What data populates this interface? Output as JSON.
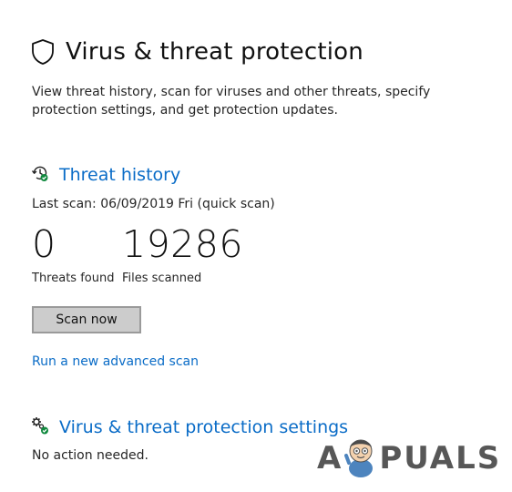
{
  "page": {
    "title": "Virus & threat protection",
    "description": "View threat history, scan for viruses and other threats, specify protection settings, and get protection updates.",
    "icon": "shield-icon"
  },
  "threat_history": {
    "heading": "Threat history",
    "icon": "history-check-icon",
    "last_scan": "Last scan: 06/09/2019 Fri (quick scan)",
    "threats_found_value": "0",
    "threats_found_label": "Threats found",
    "files_scanned_value": "19286",
    "files_scanned_label": "Files scanned",
    "scan_now_label": "Scan now",
    "advanced_scan_link": "Run a new advanced scan"
  },
  "settings": {
    "heading": "Virus & threat protection settings",
    "icon": "gears-check-icon",
    "status": "No action needed."
  },
  "watermark": {
    "text_left": "A",
    "text_right": "PUALS"
  },
  "colors": {
    "link_blue": "#0a6cc7",
    "status_green": "#10893e",
    "button_gray": "#cccccc"
  }
}
